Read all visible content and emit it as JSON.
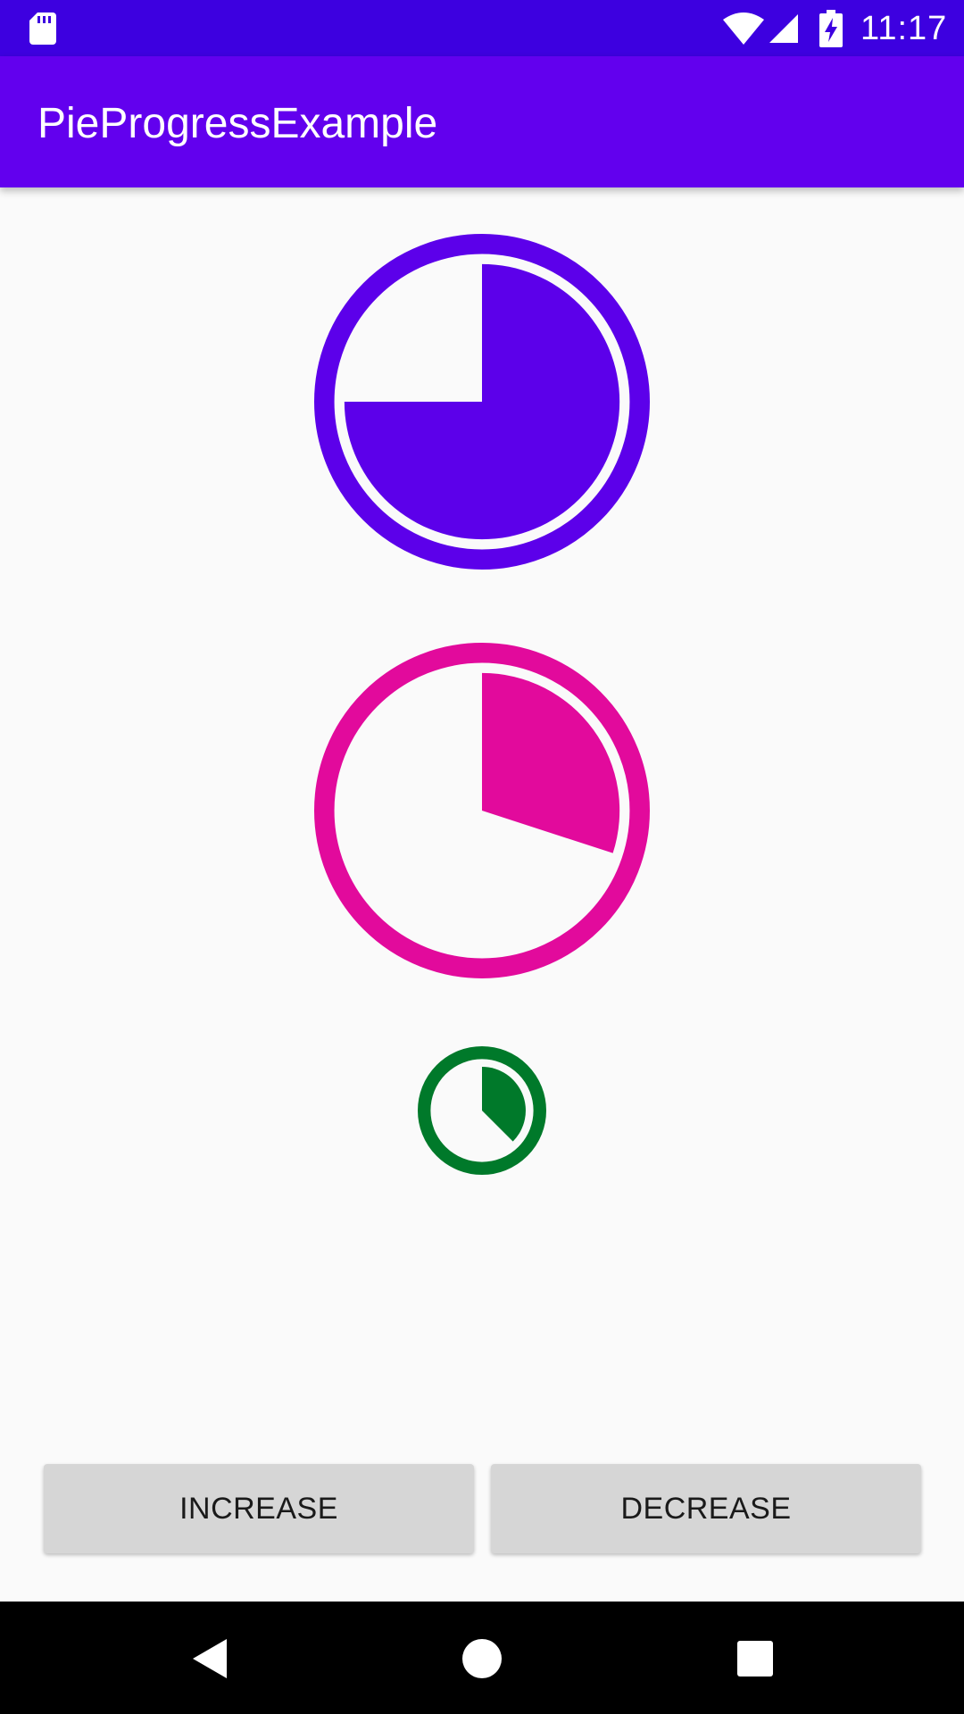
{
  "status_bar": {
    "time": "11:17",
    "icons": [
      "sd-card-icon",
      "wifi-icon",
      "signal-icon",
      "battery-charging-icon"
    ]
  },
  "app_bar": {
    "title": "PieProgressExample"
  },
  "progress_views": [
    {
      "name": "purple",
      "color": "#5c00ea",
      "progress_fraction": 0.75
    },
    {
      "name": "pink",
      "color": "#e20a9c",
      "progress_fraction": 0.3
    },
    {
      "name": "green",
      "color": "#00792a",
      "progress_fraction": 0.375
    }
  ],
  "buttons": {
    "increase_label": "INCREASE",
    "decrease_label": "DECREASE"
  },
  "nav_bar": {
    "icons": [
      "back-icon",
      "home-icon",
      "recents-icon"
    ]
  }
}
